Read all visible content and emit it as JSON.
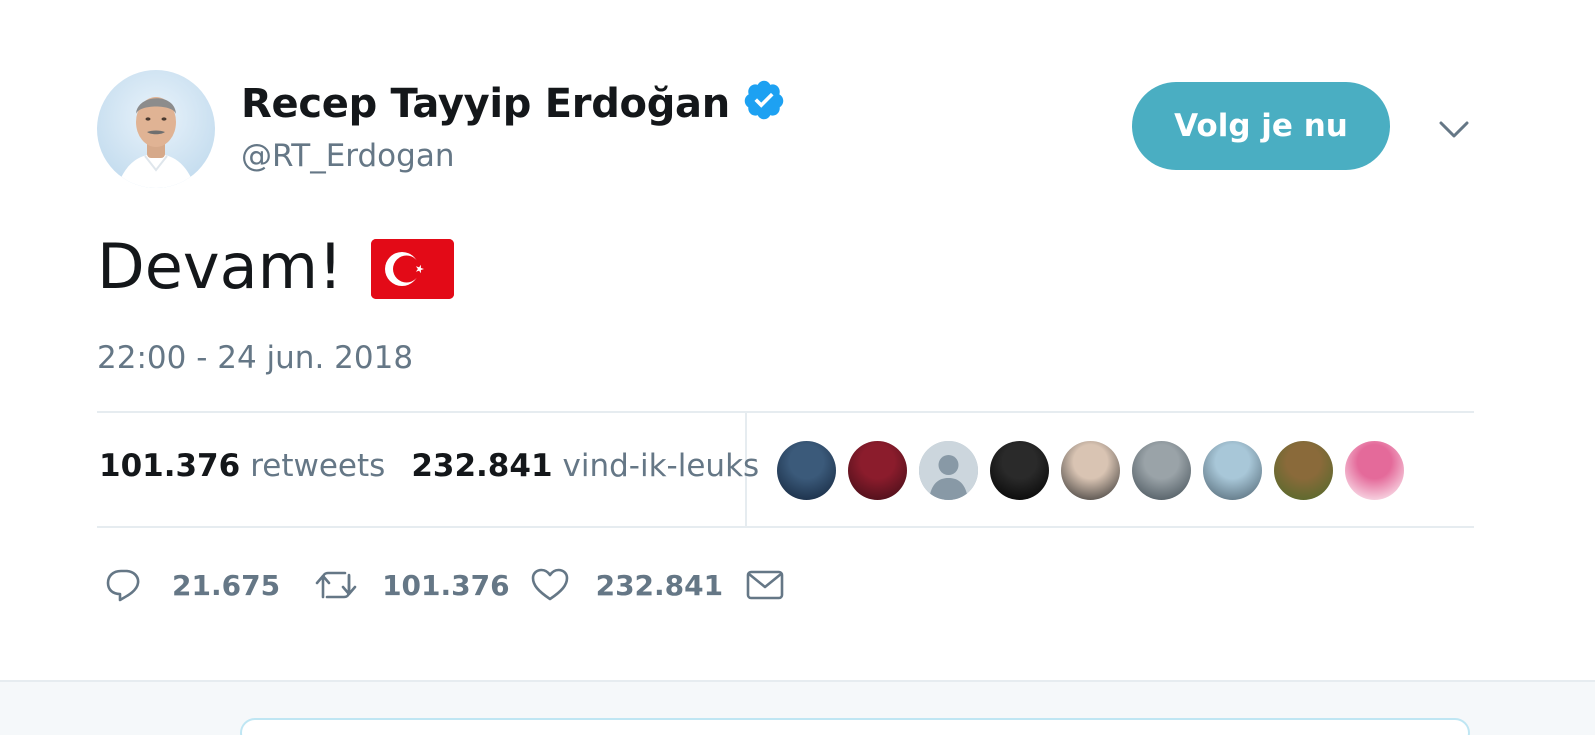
{
  "author": {
    "name": "Recep Tayyip Erdoğan",
    "handle": "@RT_Erdogan",
    "verified": true
  },
  "follow_button": {
    "label": "Volg je nu",
    "color": "#4aaec2"
  },
  "tweet": {
    "text": "Devam!",
    "emoji": "turkish-flag",
    "timestamp": "22:00 - 24 jun. 2018"
  },
  "stats": {
    "retweets": {
      "count": "101.376",
      "label": "retweets"
    },
    "likes": {
      "count": "232.841",
      "label": "vind-ik-leuks"
    }
  },
  "likers": [
    {
      "name": "liker-1",
      "colors": [
        "#3b5a7a",
        "#12233a"
      ]
    },
    {
      "name": "liker-2",
      "colors": [
        "#8b1c2c",
        "#3c0d16"
      ]
    },
    {
      "name": "liker-3",
      "colors": [
        "#c8d2da",
        "#8a99a6"
      ]
    },
    {
      "name": "liker-4",
      "colors": [
        "#2a2a2a",
        "#000000"
      ]
    },
    {
      "name": "liker-5",
      "colors": [
        "#d9c4b3",
        "#2b2b2b"
      ]
    },
    {
      "name": "liker-6",
      "colors": [
        "#9aa3a8",
        "#3e4a52"
      ]
    },
    {
      "name": "liker-7",
      "colors": [
        "#a8c7d8",
        "#4b5f6c"
      ]
    },
    {
      "name": "liker-8",
      "colors": [
        "#8a6a3a",
        "#4c6a2a"
      ]
    },
    {
      "name": "liker-9",
      "colors": [
        "#e46a9a",
        "#ffffff"
      ]
    }
  ],
  "actions": {
    "replies": "21.675",
    "retweets": "101.376",
    "likes": "232.841"
  },
  "colors": {
    "text_primary": "#14171a",
    "text_secondary": "#657786",
    "verified_blue": "#1da1f2",
    "flag_red": "#e30a17",
    "divider": "#e6ecf0"
  }
}
